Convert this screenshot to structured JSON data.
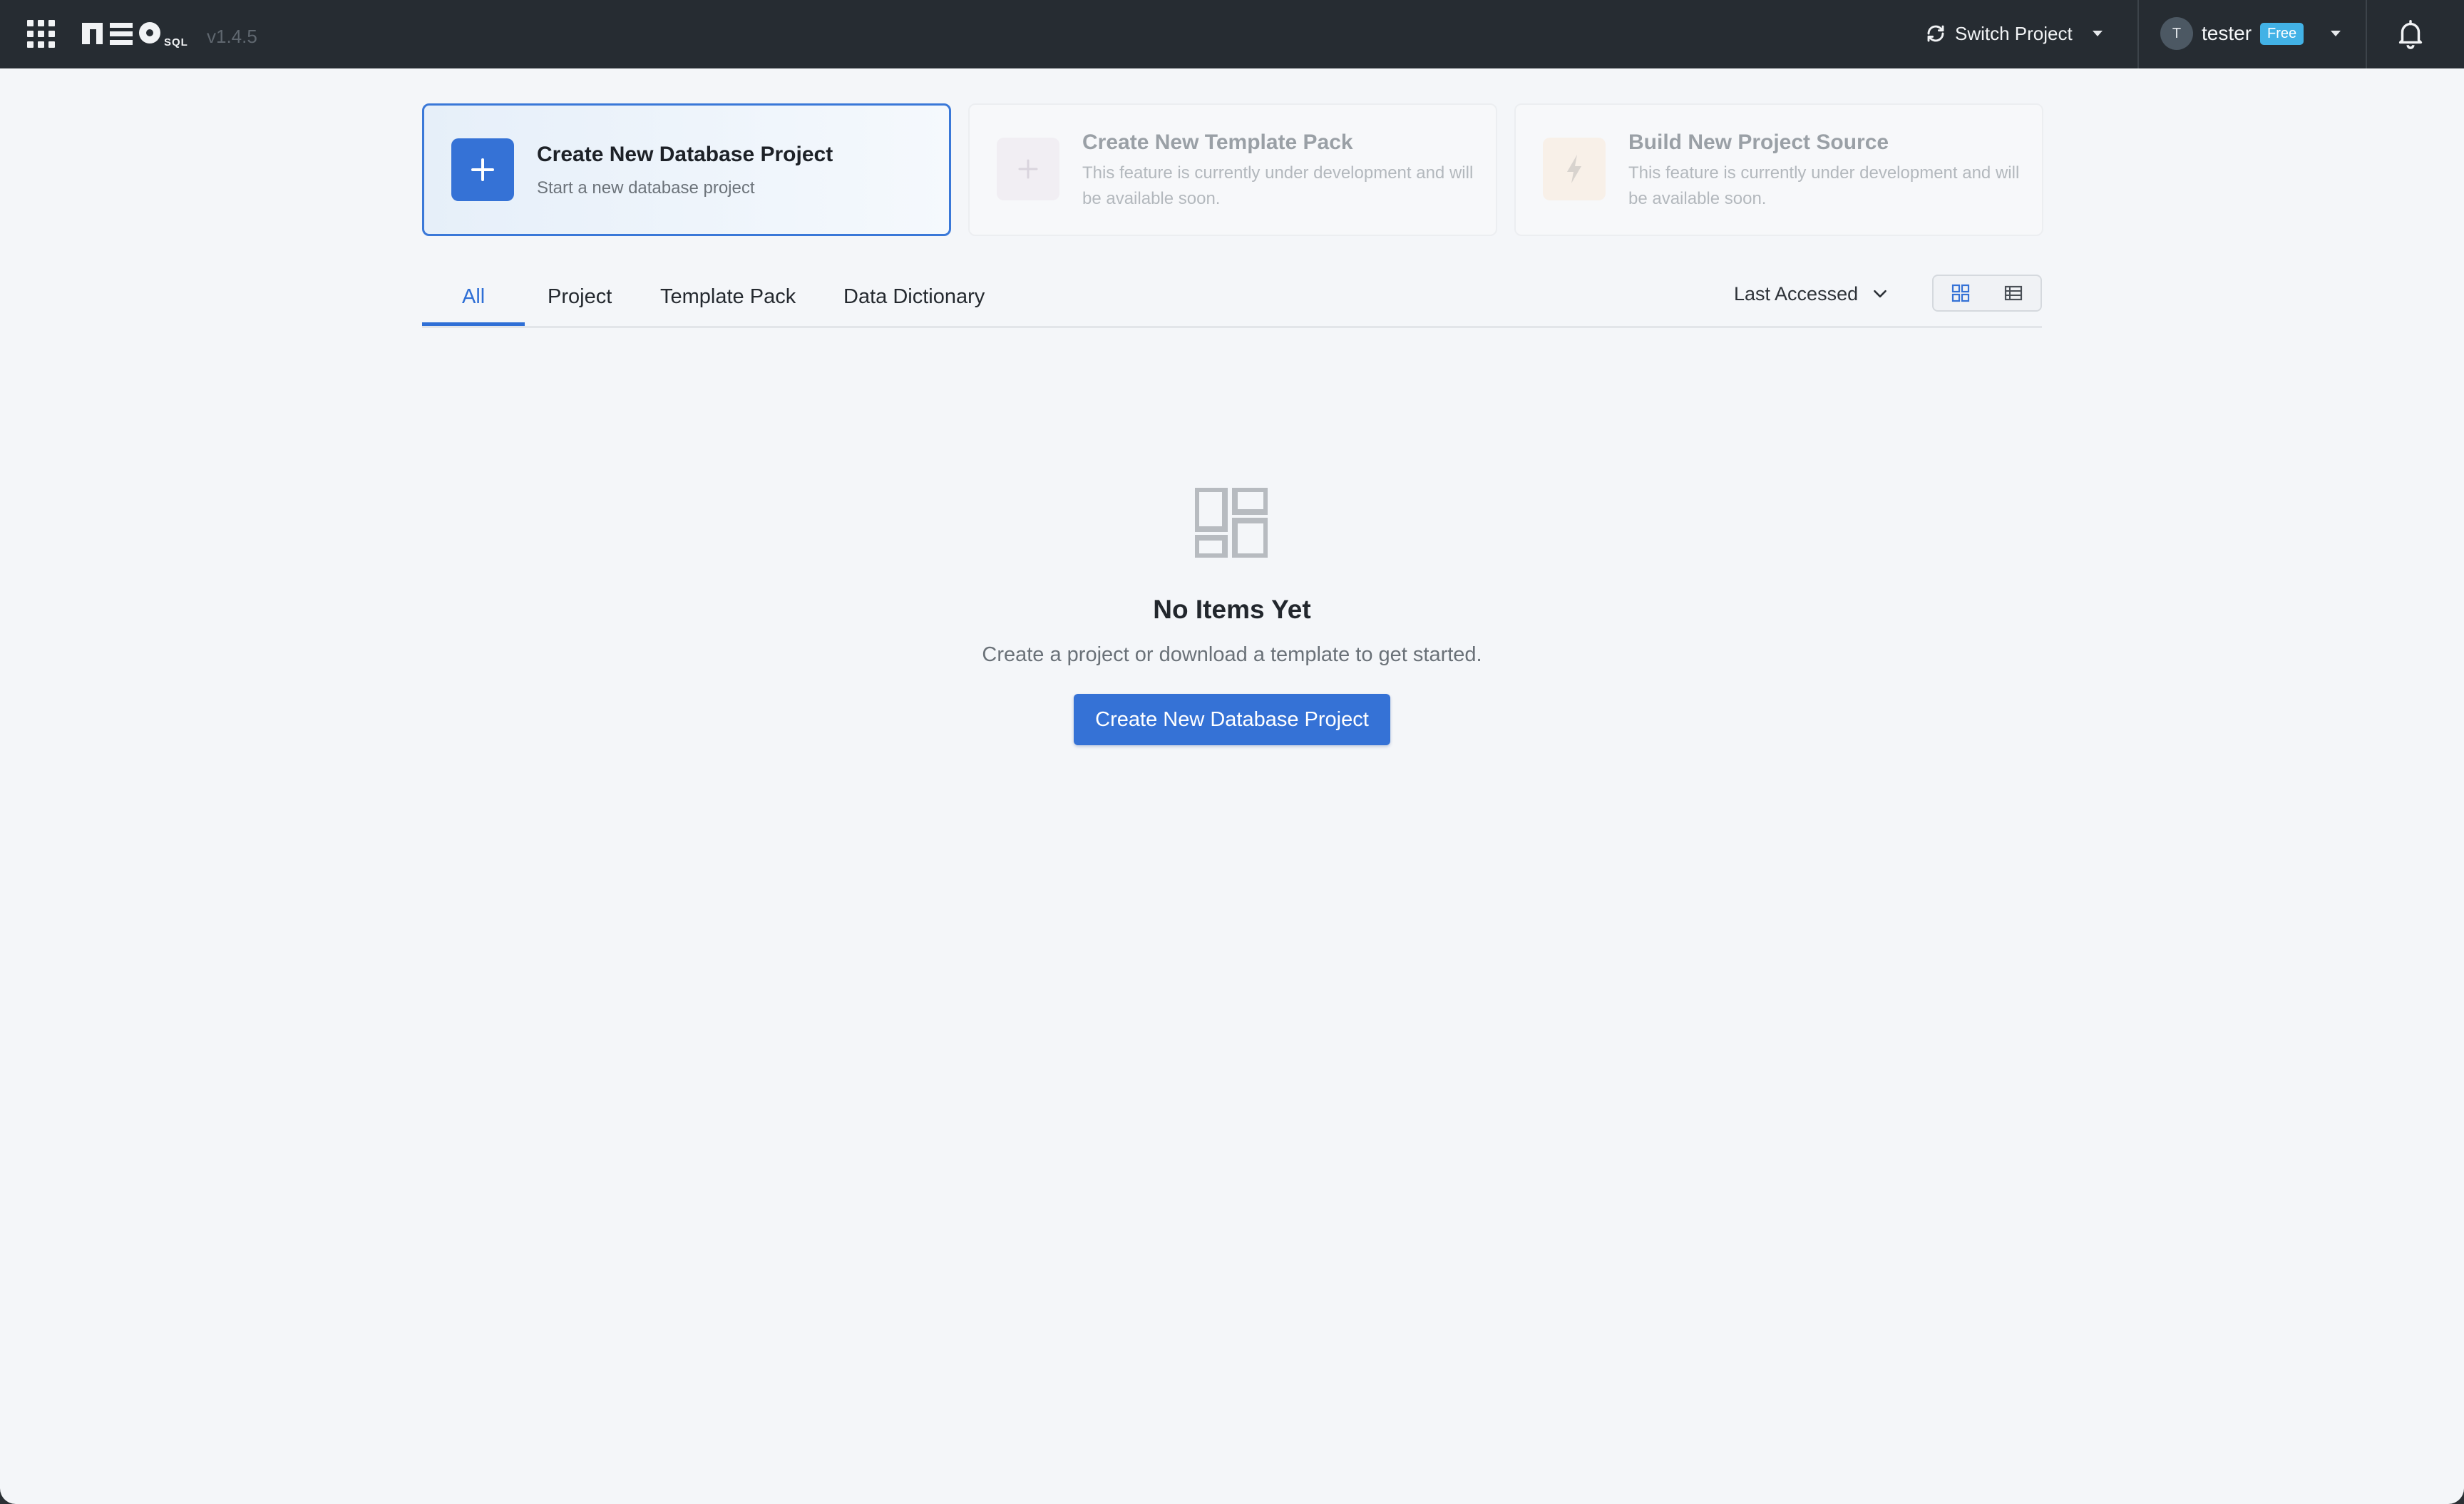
{
  "app": {
    "version": "v1.4.5",
    "logo_text": "NEO SQL"
  },
  "topbar": {
    "switch_project_label": "Switch Project",
    "user": {
      "avatar_initial": "T",
      "name": "tester",
      "plan": "Free"
    }
  },
  "action_cards": [
    {
      "title": "Create New Database Project",
      "subtitle": "Start a new database project",
      "icon": "plus-icon",
      "enabled": true
    },
    {
      "title": "Create New Template Pack",
      "subtitle": "This feature is currently under development and will be available soon.",
      "icon": "plus-icon",
      "enabled": false
    },
    {
      "title": "Build New Project Source",
      "subtitle": "This feature is currently under development and will be available soon.",
      "icon": "lightning-icon",
      "enabled": false
    }
  ],
  "tabs": [
    {
      "label": "All",
      "active": true
    },
    {
      "label": "Project",
      "active": false
    },
    {
      "label": "Template Pack",
      "active": false
    },
    {
      "label": "Data Dictionary",
      "active": false
    }
  ],
  "sort": {
    "selected": "Last Accessed"
  },
  "view_toggle": {
    "selected": "grid",
    "options": [
      "grid",
      "list"
    ]
  },
  "empty_state": {
    "title": "No Items Yet",
    "description": "Create a project or download a template to get started.",
    "button_label": "Create New Database Project"
  },
  "colors": {
    "accent": "#3572d6",
    "topbar": "#262c32",
    "background": "#f4f6f9",
    "badge": "#42b2e6"
  }
}
